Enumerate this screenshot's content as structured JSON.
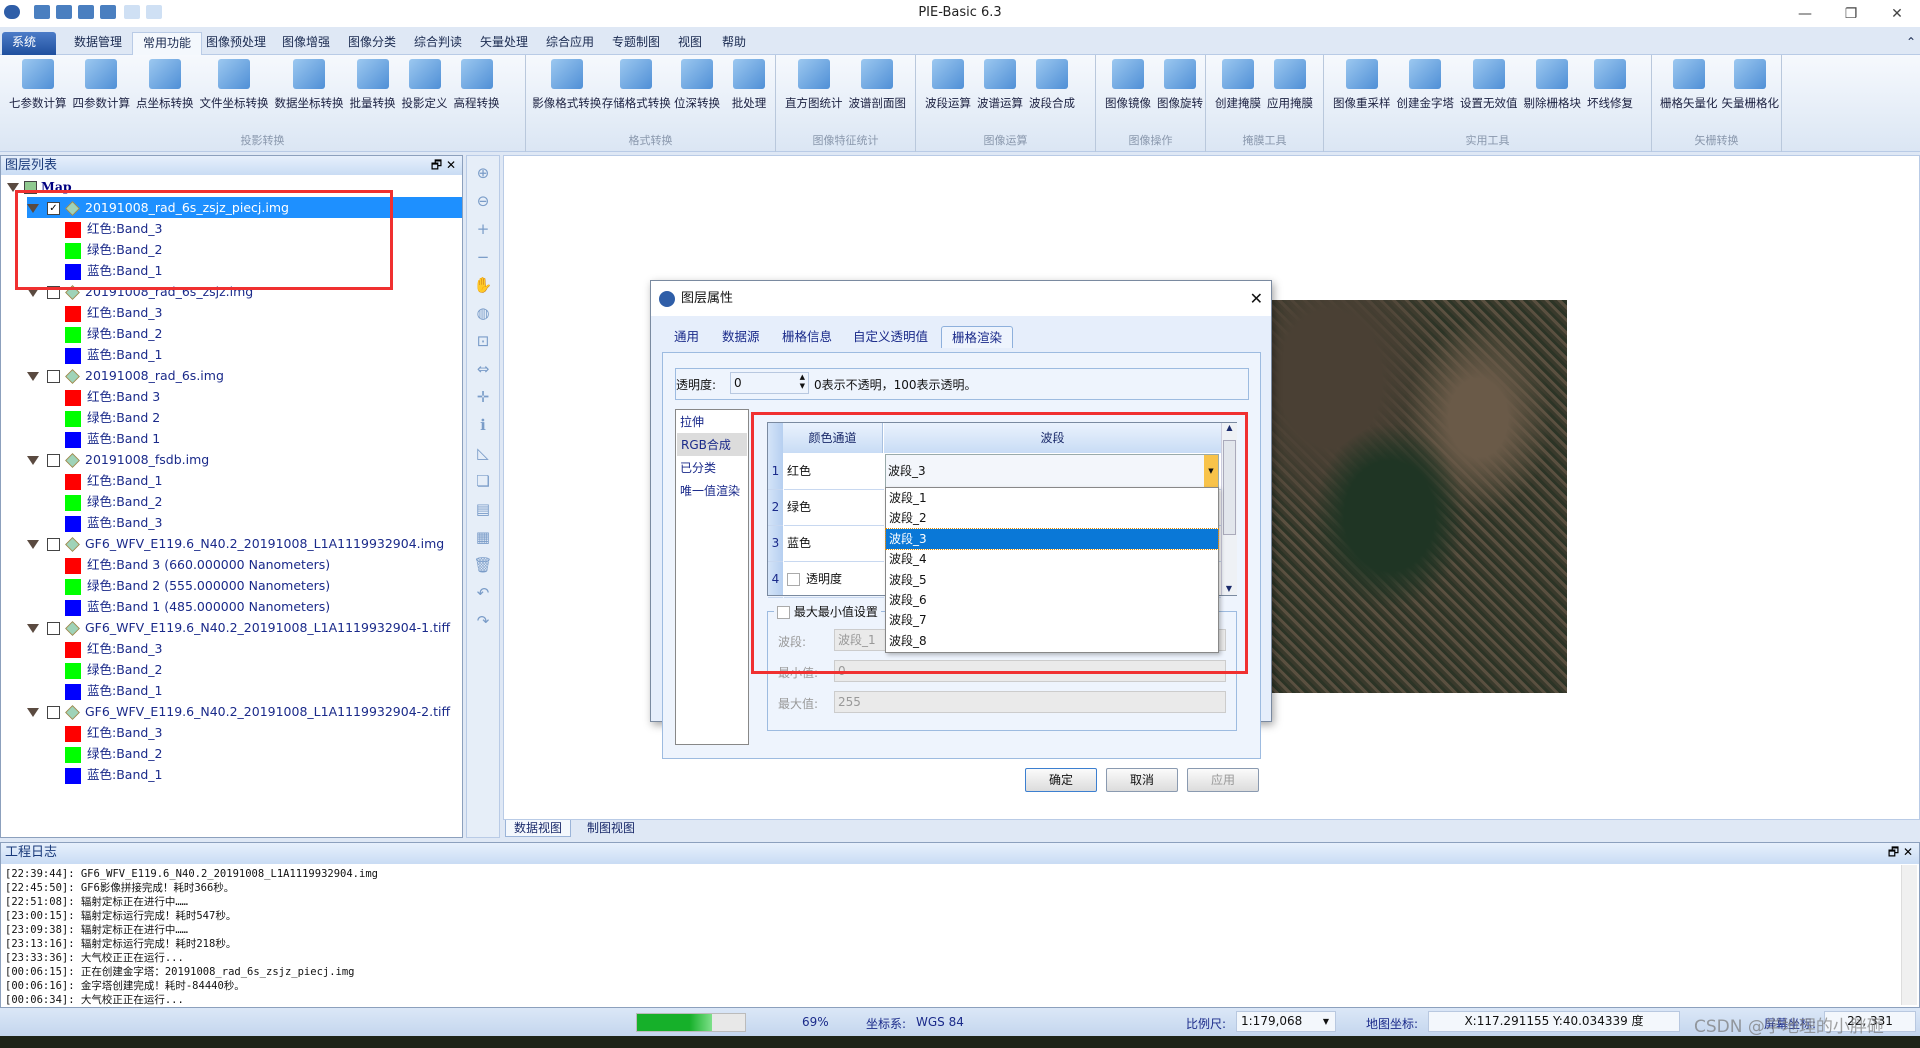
{
  "app": {
    "title": "PIE-Basic 6.3"
  },
  "quick_access": [
    "new-icon",
    "open-icon",
    "save-icon",
    "save-as-icon",
    "search-icon",
    "export-icon"
  ],
  "menu_tabs": [
    "系统",
    "数据管理",
    "常用功能",
    "图像预处理",
    "图像增强",
    "图像分类",
    "综合判读",
    "矢量处理",
    "综合应用",
    "专题制图",
    "视图",
    "帮助"
  ],
  "active_menu_tab": "常用功能",
  "ribbon": {
    "groups": [
      {
        "label": "投影转换",
        "buttons": [
          "七参数计算",
          "四参数计算",
          "点坐标转换",
          "文件坐标转换",
          "数据坐标转换",
          "批量转换",
          "投影定义",
          "高程转换"
        ]
      },
      {
        "label": "格式转换",
        "buttons": [
          "影像格式转换",
          "存储格式转换",
          "位深转换",
          "批处理"
        ]
      },
      {
        "label": "图像特征统计",
        "buttons": [
          "直方图统计",
          "波谱剖面图"
        ]
      },
      {
        "label": "图像运算",
        "buttons": [
          "波段运算",
          "波谱运算",
          "波段合成"
        ]
      },
      {
        "label": "图像操作",
        "buttons": [
          "图像镜像",
          "图像旋转"
        ]
      },
      {
        "label": "掩膜工具",
        "buttons": [
          "创建掩膜",
          "应用掩膜"
        ]
      },
      {
        "label": "实用工具",
        "buttons": [
          "图像重采样",
          "创建金字塔",
          "设置无效值",
          "剔除栅格块",
          "坏线修复"
        ]
      },
      {
        "label": "矢栅转换",
        "buttons": [
          "栅格矢量化",
          "矢量栅格化"
        ]
      }
    ]
  },
  "layer_panel": {
    "title": "图层列表",
    "root": "Map",
    "layers": [
      {
        "name": "20191008_rad_6s_zsjz_piecj.img",
        "checked": true,
        "selected": true,
        "bands": [
          "红色:Band_3",
          "绿色:Band_2",
          "蓝色:Band_1"
        ]
      },
      {
        "name": "20191008_rad_6s_zsjz.img",
        "checked": false,
        "bands": [
          "红色:Band_3",
          "绿色:Band_2",
          "蓝色:Band_1"
        ]
      },
      {
        "name": "20191008_rad_6s.img",
        "checked": false,
        "bands": [
          "红色:Band 3",
          "绿色:Band 2",
          "蓝色:Band 1"
        ]
      },
      {
        "name": "20191008_fsdb.img",
        "checked": false,
        "bands": [
          "红色:Band_1",
          "绿色:Band_2",
          "蓝色:Band_3"
        ]
      },
      {
        "name": "GF6_WFV_E119.6_N40.2_20191008_L1A1119932904.img",
        "checked": false,
        "bands": [
          "红色:Band 3 (660.000000 Nanometers)",
          "绿色:Band 2 (555.000000 Nanometers)",
          "蓝色:Band 1 (485.000000 Nanometers)"
        ]
      },
      {
        "name": "GF6_WFV_E119.6_N40.2_20191008_L1A1119932904-1.tiff",
        "checked": false,
        "bands": [
          "红色:Band_3",
          "绿色:Band_2",
          "蓝色:Band_1"
        ]
      },
      {
        "name": "GF6_WFV_E119.6_N40.2_20191008_L1A1119932904-2.tiff",
        "checked": false,
        "bands": [
          "红色:Band_3",
          "绿色:Band_2",
          "蓝色:Band_1"
        ]
      }
    ],
    "band_colors": [
      "#ff0000",
      "#00ff00",
      "#0000ff"
    ]
  },
  "view_tabs": [
    "数据视图",
    "制图视图"
  ],
  "dialog": {
    "title": "图层属性",
    "tabs": [
      "通用",
      "数据源",
      "栅格信息",
      "自定义透明值",
      "栅格渲染"
    ],
    "active_tab": "栅格渲染",
    "transparency_label": "透明度:",
    "transparency_value": "0",
    "transparency_hint": "0表示不透明，100表示透明。",
    "render_modes": [
      "拉伸",
      "RGB合成",
      "已分类",
      "唯一值渲染"
    ],
    "selected_mode": "RGB合成",
    "grid_headers": [
      "颜色通道",
      "波段"
    ],
    "grid_rows": [
      {
        "index": "1",
        "channel": "红色",
        "band": "波段_3"
      },
      {
        "index": "2",
        "channel": "绿色",
        "band": ""
      },
      {
        "index": "3",
        "channel": "蓝色",
        "band": ""
      },
      {
        "index": "4",
        "channel": "透明度",
        "band": ""
      }
    ],
    "dropdown_options": [
      "波段_1",
      "波段_2",
      "波段_3",
      "波段_4",
      "波段_5",
      "波段_6",
      "波段_7",
      "波段_8"
    ],
    "dropdown_selected": "波段_3",
    "minmax": {
      "label": "最大最小值设置",
      "band_label": "波段:",
      "band_value": "波段_1",
      "min_label": "最小值:",
      "min_value": "0",
      "max_label": "最大值:",
      "max_value": "255"
    },
    "buttons": {
      "ok": "确定",
      "cancel": "取消",
      "apply": "应用"
    }
  },
  "log_panel": {
    "title": "工程日志",
    "lines": [
      "[22:39:44]: GF6_WFV_E119.6_N40.2_20191008_L1A1119932904.img",
      "[22:45:50]: GF6影像拼接完成！耗时366秒。",
      "[22:51:08]: 辐射定标正在进行中……",
      "[23:00:15]: 辐射定标运行完成！耗时547秒。",
      "[23:09:38]: 辐射定标正在进行中……",
      "[23:13:16]: 辐射定标运行完成！耗时218秒。",
      "[23:33:36]: 大气校正正在运行...",
      "[00:06:15]: 正在创建金字塔：20191008_rad_6s_zsjz_piecj.img",
      "[00:06:16]: 金字塔创建完成！耗时-84440秒。",
      "[00:06:34]: 大气校正正在运行..."
    ]
  },
  "statusbar": {
    "progress_percent": 69,
    "progress_label": "69%",
    "crs_label": "坐标系:",
    "crs_value": "WGS 84",
    "scale_label": "比例尺:",
    "scale_value": "1:179,068",
    "map_coord_label": "地图坐标:",
    "map_coord_value": "X:117.291155 Y:40.034339 度",
    "screen_coord_label": "屏幕坐标:",
    "screen_coord_value": "22, 331"
  },
  "watermark": "CSDN @学地理的小胖砸",
  "colors": {
    "accent": "#0a78d7",
    "highlight_box": "#f03030",
    "selection": "#1e90ff"
  }
}
